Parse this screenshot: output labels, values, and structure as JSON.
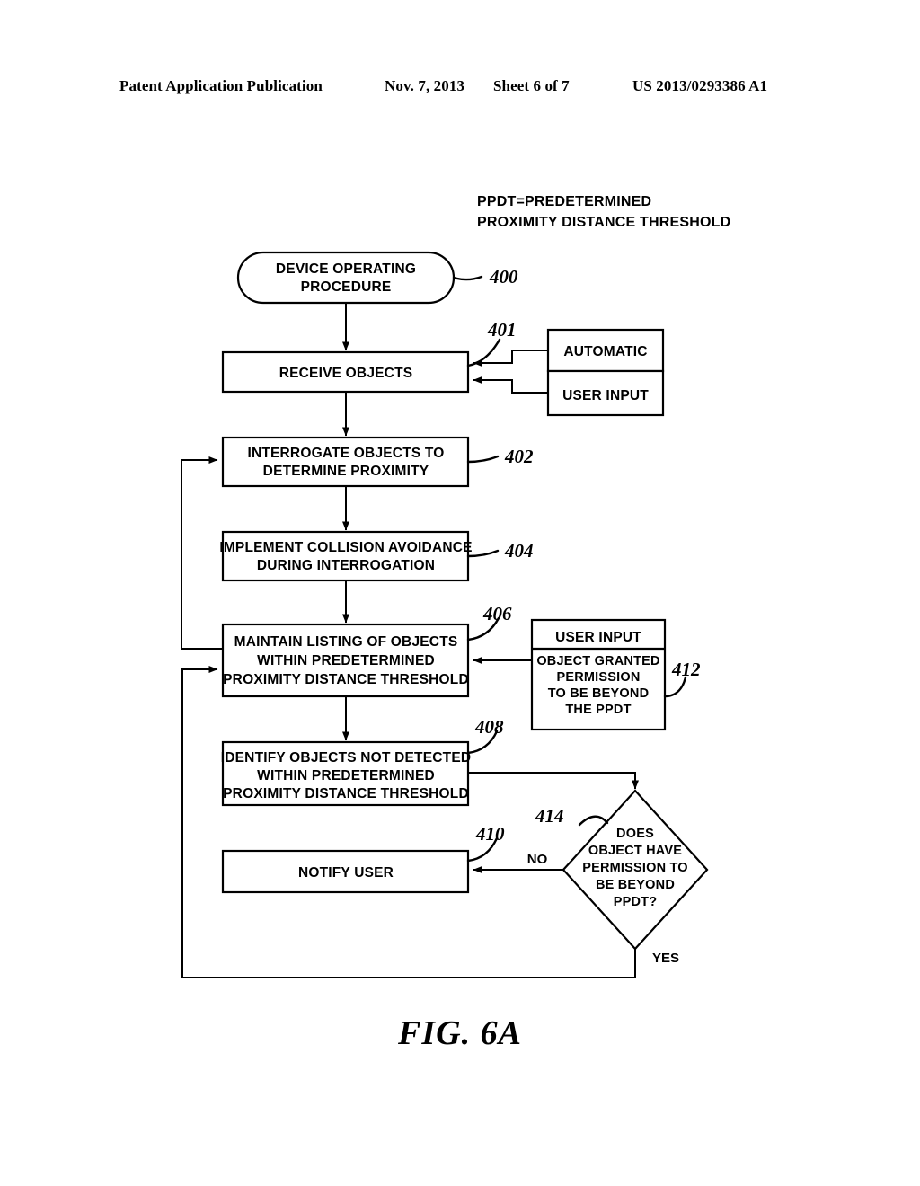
{
  "header": {
    "publication": "Patent Application Publication",
    "date": "Nov. 7, 2013",
    "sheet": "Sheet 6 of 7",
    "patent_number": "US 2013/0293386 A1"
  },
  "figure": {
    "caption": "FIG.  6A",
    "legend": {
      "line1": "PPDT=PREDETERMINED",
      "line2": "PROXIMITY DISTANCE THRESHOLD"
    },
    "nodes": {
      "start": {
        "ref": "400",
        "line1": "DEVICE OPERATING",
        "line2": "PROCEDURE"
      },
      "receive_objects": {
        "ref": "401",
        "line1": "RECEIVE OBJECTS"
      },
      "automatic": {
        "line1": "AUTOMATIC"
      },
      "user_input_source": {
        "line1": "USER INPUT"
      },
      "interrogate": {
        "ref": "402",
        "line1": "INTERROGATE OBJECTS TO",
        "line2": "DETERMINE PROXIMITY"
      },
      "collision_avoidance": {
        "ref": "404",
        "line1": "IMPLEMENT COLLISION AVOIDANCE",
        "line2": "DURING INTERROGATION"
      },
      "maintain_listing": {
        "ref": "406",
        "line1": "MAINTAIN LISTING OF OBJECTS",
        "line2": "WITHIN PREDETERMINED",
        "line3": "PROXIMITY DISTANCE THRESHOLD"
      },
      "user_permission": {
        "ref": "412",
        "header": "USER INPUT",
        "line1": "OBJECT GRANTED",
        "line2": "PERMISSION",
        "line3": "TO BE BEYOND",
        "line4": "THE PPDT"
      },
      "identify_objects": {
        "ref": "408",
        "line1": "IDENTIFY OBJECTS NOT DETECTED",
        "line2": "WITHIN PREDETERMINED",
        "line3": "PROXIMITY DISTANCE THRESHOLD"
      },
      "notify_user": {
        "ref": "410",
        "line1": "NOTIFY USER"
      },
      "decision": {
        "ref": "414",
        "line1": "DOES",
        "line2": "OBJECT HAVE",
        "line3": "PERMISSION TO",
        "line4": "BE BEYOND",
        "line5": "PPDT?"
      }
    },
    "edge_labels": {
      "no": "NO",
      "yes": "YES"
    }
  }
}
